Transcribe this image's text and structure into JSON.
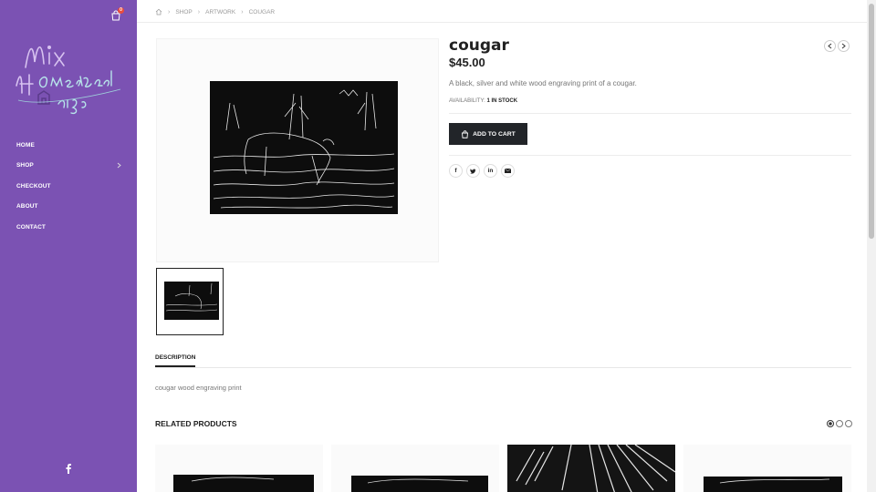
{
  "sidebar": {
    "cart_count": "0",
    "logo_text": "Mix Homestead Designs",
    "nav": [
      {
        "label": "HOME"
      },
      {
        "label": "SHOP",
        "has_submenu": true
      },
      {
        "label": "CHECKOUT"
      },
      {
        "label": "ABOUT"
      },
      {
        "label": "CONTACT"
      }
    ],
    "social_icon": "facebook-icon"
  },
  "breadcrumb": {
    "home_icon": "home-icon",
    "items": [
      "SHOP",
      "ARTWORK",
      "COUGAR"
    ]
  },
  "product": {
    "title": "cougar",
    "price": "$45.00",
    "short_description": "A black, silver and white wood engraving print of a cougar.",
    "availability_label": "AVAILABILITY:",
    "availability_value": "1 IN STOCK",
    "add_to_cart_label": "ADD TO CART",
    "share": [
      "facebook-icon",
      "twitter-icon",
      "linkedin-icon",
      "email-icon"
    ],
    "nav": [
      "prev-icon",
      "next-icon"
    ]
  },
  "tabs": {
    "description_label": "DESCRIPTION",
    "description_text": "cougar wood engraving print"
  },
  "related": {
    "title": "RELATED PRODUCTS",
    "pages": 3,
    "active_page": 1
  },
  "colors": {
    "sidebar": "#7b52b3",
    "button": "#222529",
    "badge": "#e84c3d"
  }
}
